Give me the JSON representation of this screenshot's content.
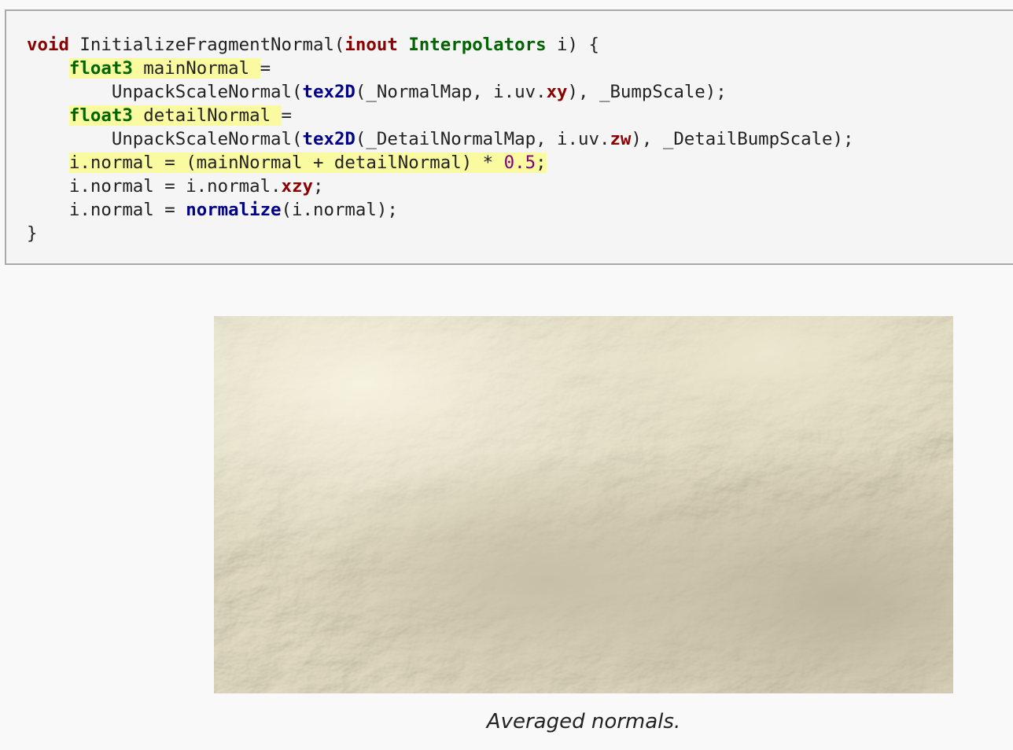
{
  "code": {
    "lines": [
      [
        {
          "t": "void",
          "c": "kw-red"
        },
        {
          "t": " InitializeFragmentNormal(",
          "c": "plain"
        },
        {
          "t": "inout",
          "c": "kw-red"
        },
        {
          "t": " ",
          "c": "plain"
        },
        {
          "t": "Interpolators",
          "c": "kw-green"
        },
        {
          "t": " i) {",
          "c": "plain"
        }
      ],
      [
        {
          "t": "    ",
          "c": "plain"
        },
        {
          "t": "float3",
          "c": "kw-green",
          "hl": true
        },
        {
          "t": " mainNormal ",
          "c": "plain",
          "hl": true
        },
        {
          "t": "=",
          "c": "plain"
        }
      ],
      [
        {
          "t": "        UnpackScaleNormal(",
          "c": "plain"
        },
        {
          "t": "tex2D",
          "c": "kw-blue"
        },
        {
          "t": "(_NormalMap, i.uv.",
          "c": "plain"
        },
        {
          "t": "xy",
          "c": "kw-red"
        },
        {
          "t": "), _BumpScale);",
          "c": "plain"
        }
      ],
      [
        {
          "t": "    ",
          "c": "plain"
        },
        {
          "t": "float3",
          "c": "kw-green",
          "hl": true
        },
        {
          "t": " detailNormal ",
          "c": "plain",
          "hl": true
        },
        {
          "t": "=",
          "c": "plain"
        }
      ],
      [
        {
          "t": "        UnpackScaleNormal(",
          "c": "plain"
        },
        {
          "t": "tex2D",
          "c": "kw-blue"
        },
        {
          "t": "(_DetailNormalMap, i.uv.",
          "c": "plain"
        },
        {
          "t": "zw",
          "c": "kw-red"
        },
        {
          "t": "), _DetailBumpScale);",
          "c": "plain"
        }
      ],
      [
        {
          "t": "    ",
          "c": "plain"
        },
        {
          "t": "i.normal = (mainNormal + detailNormal) * ",
          "c": "plain",
          "hl": true
        },
        {
          "t": "0.5",
          "c": "num",
          "hl": true
        },
        {
          "t": ";",
          "c": "plain",
          "hl": true
        }
      ],
      [
        {
          "t": "    i.normal = i.normal.",
          "c": "plain"
        },
        {
          "t": "xzy",
          "c": "kw-red"
        },
        {
          "t": ";",
          "c": "plain"
        }
      ],
      [
        {
          "t": "    i.normal = ",
          "c": "plain"
        },
        {
          "t": "normalize",
          "c": "kw-blue"
        },
        {
          "t": "(i.normal);",
          "c": "plain"
        }
      ],
      [
        {
          "t": "}",
          "c": "plain"
        }
      ]
    ]
  },
  "figure": {
    "caption": "Averaged normals."
  },
  "colors": {
    "keyword_red": "#8b0000",
    "type_green": "#006400",
    "builtin_blue": "#00008b",
    "number_purple": "#800080",
    "highlight": "#fafaa0",
    "surface": "#ddd6bd"
  }
}
